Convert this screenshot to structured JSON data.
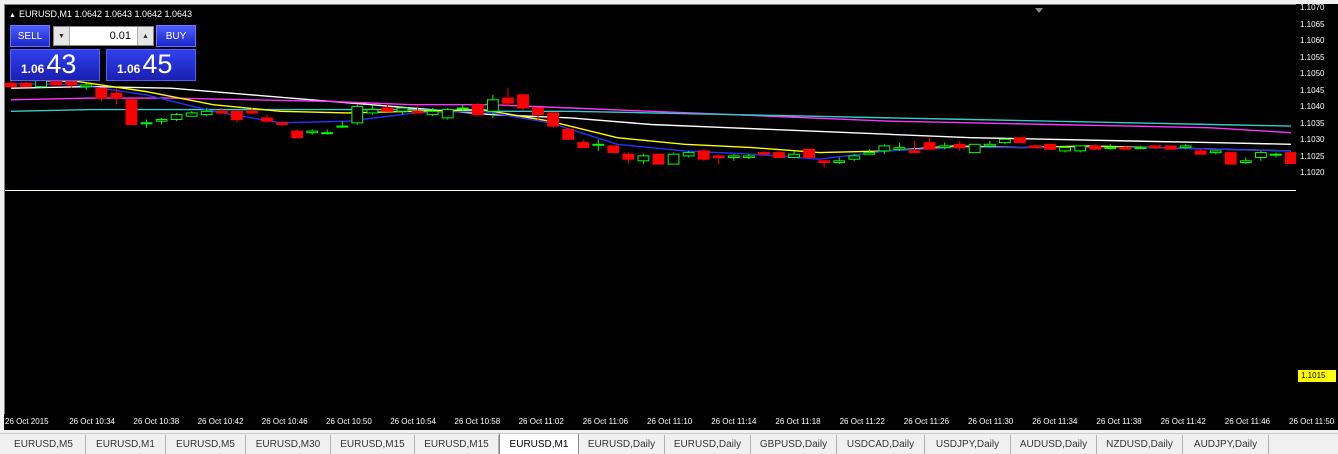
{
  "chart": {
    "symbol_line": "EURUSD,M1  1.0642 1.0643 1.0642 1.0643",
    "background": "#000000",
    "colors": {
      "bull": "#00ff00",
      "bear": "#ff0000",
      "ma_white": "#ffffff",
      "ma_magenta": "#ff33ff",
      "ma_cyan": "#33cccc",
      "ma_yellow": "#ffff00",
      "ma_blue": "#2233ff",
      "bid_line": "#ffffcc"
    }
  },
  "trade_panel": {
    "sell_label": "SELL",
    "buy_label": "BUY",
    "lot": "0.01",
    "bid_small": "1.06",
    "bid_big": "43",
    "ask_small": "1.06",
    "ask_big": "45"
  },
  "price_axis": {
    "ticks": [
      "1.1070",
      "1.1065",
      "1.1060",
      "1.1055",
      "1.1050",
      "1.1045",
      "1.1040",
      "1.1035",
      "1.1030",
      "1.1025",
      "1.1020"
    ],
    "current": "1.1015"
  },
  "time_axis": {
    "ticks": [
      "26 Oct 2015",
      "26 Oct 10:34",
      "26 Oct 10:38",
      "26 Oct 10:42",
      "26 Oct 10:46",
      "26 Oct 10:50",
      "26 Oct 10:54",
      "26 Oct 10:58",
      "26 Oct 11:02",
      "26 Oct 11:06",
      "26 Oct 11:10",
      "26 Oct 11:14",
      "26 Oct 11:18",
      "26 Oct 11:22",
      "26 Oct 11:26",
      "26 Oct 11:30",
      "26 Oct 11:34",
      "26 Oct 11:38",
      "26 Oct 11:42",
      "26 Oct 11:46",
      "26 Oct 11:50"
    ]
  },
  "tabs": [
    {
      "label": "EURUSD,M5",
      "active": false
    },
    {
      "label": "EURUSD,M1",
      "active": false
    },
    {
      "label": "EURUSD,M5",
      "active": false
    },
    {
      "label": "EURUSD,M30",
      "active": false
    },
    {
      "label": "EURUSD,M15",
      "active": false
    },
    {
      "label": "EURUSD,M15",
      "active": false
    },
    {
      "label": "EURUSD,M1",
      "active": true
    },
    {
      "label": "EURUSD,Daily",
      "active": false
    },
    {
      "label": "EURUSD,Daily",
      "active": false
    },
    {
      "label": "GBPUSD,Daily",
      "active": false
    },
    {
      "label": "USDCAD,Daily",
      "active": false
    },
    {
      "label": "USDJPY,Daily",
      "active": false
    },
    {
      "label": "AUDUSD,Daily",
      "active": false
    },
    {
      "label": "NZDUSD,Daily",
      "active": false
    },
    {
      "label": "AUDJPY,Daily",
      "active": false
    }
  ],
  "chart_data": {
    "type": "candlestick",
    "title": "EURUSD,M1",
    "ylim": [
      1.1013,
      1.1071
    ],
    "current_price": 1.1015,
    "candles": [
      {
        "o": 1.10475,
        "h": 1.1049,
        "l": 1.1046,
        "c": 1.10465
      },
      {
        "o": 1.10475,
        "h": 1.1048,
        "l": 1.10465,
        "c": 1.10465
      },
      {
        "o": 1.10465,
        "h": 1.10495,
        "l": 1.1046,
        "c": 1.1049
      },
      {
        "o": 1.10498,
        "h": 1.10502,
        "l": 1.1047,
        "c": 1.1047
      },
      {
        "o": 1.1048,
        "h": 1.10482,
        "l": 1.1046,
        "c": 1.1047
      },
      {
        "o": 1.10465,
        "h": 1.10475,
        "l": 1.10455,
        "c": 1.1047
      },
      {
        "o": 1.1046,
        "h": 1.1046,
        "l": 1.1042,
        "c": 1.1043
      },
      {
        "o": 1.10445,
        "h": 1.1046,
        "l": 1.1041,
        "c": 1.1043
      },
      {
        "o": 1.10425,
        "h": 1.10425,
        "l": 1.1035,
        "c": 1.1035
      },
      {
        "o": 1.10355,
        "h": 1.10365,
        "l": 1.1034,
        "c": 1.10355
      },
      {
        "o": 1.1036,
        "h": 1.1037,
        "l": 1.1035,
        "c": 1.10365
      },
      {
        "o": 1.10365,
        "h": 1.10385,
        "l": 1.1036,
        "c": 1.1038
      },
      {
        "o": 1.10375,
        "h": 1.1039,
        "l": 1.10375,
        "c": 1.10385
      },
      {
        "o": 1.1038,
        "h": 1.104,
        "l": 1.10375,
        "c": 1.1039
      },
      {
        "o": 1.1039,
        "h": 1.104,
        "l": 1.10385,
        "c": 1.10385
      },
      {
        "o": 1.1039,
        "h": 1.1039,
        "l": 1.10355,
        "c": 1.10365
      },
      {
        "o": 1.1039,
        "h": 1.104,
        "l": 1.1038,
        "c": 1.10385
      },
      {
        "o": 1.1037,
        "h": 1.1038,
        "l": 1.10355,
        "c": 1.1036
      },
      {
        "o": 1.10355,
        "h": 1.1036,
        "l": 1.10345,
        "c": 1.1035
      },
      {
        "o": 1.1033,
        "h": 1.10335,
        "l": 1.1031,
        "c": 1.1031
      },
      {
        "o": 1.10325,
        "h": 1.10335,
        "l": 1.1032,
        "c": 1.1033
      },
      {
        "o": 1.10325,
        "h": 1.10335,
        "l": 1.1032,
        "c": 1.10325
      },
      {
        "o": 1.10345,
        "h": 1.1036,
        "l": 1.1034,
        "c": 1.10345
      },
      {
        "o": 1.10355,
        "h": 1.1041,
        "l": 1.1035,
        "c": 1.10405
      },
      {
        "o": 1.10385,
        "h": 1.1041,
        "l": 1.1038,
        "c": 1.10395
      },
      {
        "o": 1.104,
        "h": 1.1041,
        "l": 1.1039,
        "c": 1.1039
      },
      {
        "o": 1.1039,
        "h": 1.104,
        "l": 1.1038,
        "c": 1.104
      },
      {
        "o": 1.1039,
        "h": 1.1041,
        "l": 1.10385,
        "c": 1.10385
      },
      {
        "o": 1.1038,
        "h": 1.104,
        "l": 1.10375,
        "c": 1.1039
      },
      {
        "o": 1.1037,
        "h": 1.104,
        "l": 1.10365,
        "c": 1.10395
      },
      {
        "o": 1.104,
        "h": 1.1041,
        "l": 1.1039,
        "c": 1.104
      },
      {
        "o": 1.1041,
        "h": 1.10415,
        "l": 1.10375,
        "c": 1.1038
      },
      {
        "o": 1.1039,
        "h": 1.1044,
        "l": 1.1037,
        "c": 1.10425
      },
      {
        "o": 1.1043,
        "h": 1.1046,
        "l": 1.10405,
        "c": 1.10415
      },
      {
        "o": 1.1044,
        "h": 1.1044,
        "l": 1.1039,
        "c": 1.104
      },
      {
        "o": 1.104,
        "h": 1.104,
        "l": 1.1036,
        "c": 1.1038
      },
      {
        "o": 1.10385,
        "h": 1.10385,
        "l": 1.1034,
        "c": 1.10345
      },
      {
        "o": 1.10335,
        "h": 1.1034,
        "l": 1.10305,
        "c": 1.10305
      },
      {
        "o": 1.10295,
        "h": 1.10305,
        "l": 1.1028,
        "c": 1.1028
      },
      {
        "o": 1.1029,
        "h": 1.10305,
        "l": 1.1027,
        "c": 1.1029
      },
      {
        "o": 1.10285,
        "h": 1.10285,
        "l": 1.10265,
        "c": 1.10265
      },
      {
        "o": 1.1026,
        "h": 1.10265,
        "l": 1.1023,
        "c": 1.10245
      },
      {
        "o": 1.1024,
        "h": 1.1026,
        "l": 1.1023,
        "c": 1.10255
      },
      {
        "o": 1.1026,
        "h": 1.1026,
        "l": 1.1023,
        "c": 1.1023
      },
      {
        "o": 1.1023,
        "h": 1.10265,
        "l": 1.1023,
        "c": 1.1026
      },
      {
        "o": 1.10255,
        "h": 1.1027,
        "l": 1.1025,
        "c": 1.10265
      },
      {
        "o": 1.1027,
        "h": 1.1027,
        "l": 1.1024,
        "c": 1.10245
      },
      {
        "o": 1.10255,
        "h": 1.1026,
        "l": 1.1023,
        "c": 1.1025
      },
      {
        "o": 1.1025,
        "h": 1.1026,
        "l": 1.1024,
        "c": 1.10255
      },
      {
        "o": 1.1025,
        "h": 1.1026,
        "l": 1.10245,
        "c": 1.10255
      },
      {
        "o": 1.10265,
        "h": 1.1027,
        "l": 1.1026,
        "c": 1.1026
      },
      {
        "o": 1.10265,
        "h": 1.1027,
        "l": 1.1025,
        "c": 1.1025
      },
      {
        "o": 1.1025,
        "h": 1.1027,
        "l": 1.1025,
        "c": 1.1026
      },
      {
        "o": 1.10275,
        "h": 1.10275,
        "l": 1.1025,
        "c": 1.1025
      },
      {
        "o": 1.1024,
        "h": 1.1024,
        "l": 1.1022,
        "c": 1.10235
      },
      {
        "o": 1.10235,
        "h": 1.1025,
        "l": 1.1023,
        "c": 1.1024
      },
      {
        "o": 1.10245,
        "h": 1.1026,
        "l": 1.1024,
        "c": 1.10255
      },
      {
        "o": 1.1026,
        "h": 1.10275,
        "l": 1.1026,
        "c": 1.10265
      },
      {
        "o": 1.1027,
        "h": 1.1029,
        "l": 1.1026,
        "c": 1.10285
      },
      {
        "o": 1.10275,
        "h": 1.10295,
        "l": 1.1027,
        "c": 1.1028
      },
      {
        "o": 1.1027,
        "h": 1.103,
        "l": 1.10265,
        "c": 1.10265
      },
      {
        "o": 1.10295,
        "h": 1.1031,
        "l": 1.10275,
        "c": 1.10275
      },
      {
        "o": 1.1028,
        "h": 1.10295,
        "l": 1.10275,
        "c": 1.10285
      },
      {
        "o": 1.1029,
        "h": 1.103,
        "l": 1.1027,
        "c": 1.1028
      },
      {
        "o": 1.10265,
        "h": 1.1029,
        "l": 1.10265,
        "c": 1.1029
      },
      {
        "o": 1.10285,
        "h": 1.103,
        "l": 1.1028,
        "c": 1.1029
      },
      {
        "o": 1.10295,
        "h": 1.10305,
        "l": 1.1029,
        "c": 1.10305
      },
      {
        "o": 1.1031,
        "h": 1.1031,
        "l": 1.10295,
        "c": 1.10295
      },
      {
        "o": 1.10285,
        "h": 1.1029,
        "l": 1.1028,
        "c": 1.1028
      },
      {
        "o": 1.1029,
        "h": 1.1029,
        "l": 1.10275,
        "c": 1.10275
      },
      {
        "o": 1.1027,
        "h": 1.10285,
        "l": 1.10265,
        "c": 1.1028
      },
      {
        "o": 1.1027,
        "h": 1.1028,
        "l": 1.10265,
        "c": 1.10285
      },
      {
        "o": 1.10285,
        "h": 1.1029,
        "l": 1.10275,
        "c": 1.10275
      },
      {
        "o": 1.1028,
        "h": 1.1029,
        "l": 1.10275,
        "c": 1.1028
      },
      {
        "o": 1.1028,
        "h": 1.10285,
        "l": 1.10275,
        "c": 1.10275
      },
      {
        "o": 1.1028,
        "h": 1.10285,
        "l": 1.10275,
        "c": 1.1028
      },
      {
        "o": 1.10285,
        "h": 1.10285,
        "l": 1.10275,
        "c": 1.1028
      },
      {
        "o": 1.10285,
        "h": 1.10285,
        "l": 1.10275,
        "c": 1.10275
      },
      {
        "o": 1.1028,
        "h": 1.1029,
        "l": 1.10275,
        "c": 1.10285
      },
      {
        "o": 1.1027,
        "h": 1.10275,
        "l": 1.1026,
        "c": 1.1026
      },
      {
        "o": 1.10265,
        "h": 1.1027,
        "l": 1.1026,
        "c": 1.1027
      },
      {
        "o": 1.10265,
        "h": 1.10265,
        "l": 1.1023,
        "c": 1.1023
      },
      {
        "o": 1.10235,
        "h": 1.1025,
        "l": 1.1023,
        "c": 1.1024
      },
      {
        "o": 1.1025,
        "h": 1.1027,
        "l": 1.1024,
        "c": 1.10265
      },
      {
        "o": 1.1026,
        "h": 1.10265,
        "l": 1.1025,
        "c": 1.1026
      },
      {
        "o": 1.10265,
        "h": 1.10265,
        "l": 1.1023,
        "c": 1.10232
      }
    ],
    "moving_averages": [
      {
        "color": "#ffffff",
        "values": [
          1.1046,
          1.10465,
          1.1046,
          1.1044,
          1.1042,
          1.104,
          1.1038,
          1.1037,
          1.1035,
          1.1034,
          1.1033,
          1.1032,
          1.1031,
          1.10305,
          1.103,
          1.10295,
          1.1029
        ]
      },
      {
        "color": "#ff33ff",
        "values": [
          1.10425,
          1.1043,
          1.1043,
          1.10425,
          1.1042,
          1.1041,
          1.1041,
          1.104,
          1.1039,
          1.1038,
          1.1037,
          1.1036,
          1.10355,
          1.1035,
          1.10345,
          1.1034,
          1.10325
        ]
      },
      {
        "color": "#33cccc",
        "values": [
          1.1039,
          1.10395,
          1.10395,
          1.10395,
          1.10395,
          1.10395,
          1.1039,
          1.1039,
          1.10385,
          1.1038,
          1.10375,
          1.1037,
          1.10365,
          1.1036,
          1.10355,
          1.1035,
          1.10345
        ]
      },
      {
        "color": "#ffff00",
        "values": [
          1.10485,
          1.1048,
          1.1045,
          1.1041,
          1.1039,
          1.10385,
          1.1039,
          1.10395,
          1.1036,
          1.1031,
          1.1029,
          1.1028,
          1.10265,
          1.1027,
          1.10285,
          1.1028,
          1.10285,
          1.1028,
          1.10275,
          1.1027
        ]
      },
      {
        "color": "#2233ff",
        "values": [
          1.10475,
          1.1047,
          1.1044,
          1.1039,
          1.10355,
          1.1036,
          1.10385,
          1.1039,
          1.10355,
          1.1029,
          1.1027,
          1.1026,
          1.10245,
          1.1027,
          1.1028,
          1.1028,
          1.1028,
          1.1028,
          1.10275,
          1.1027
        ]
      }
    ]
  }
}
